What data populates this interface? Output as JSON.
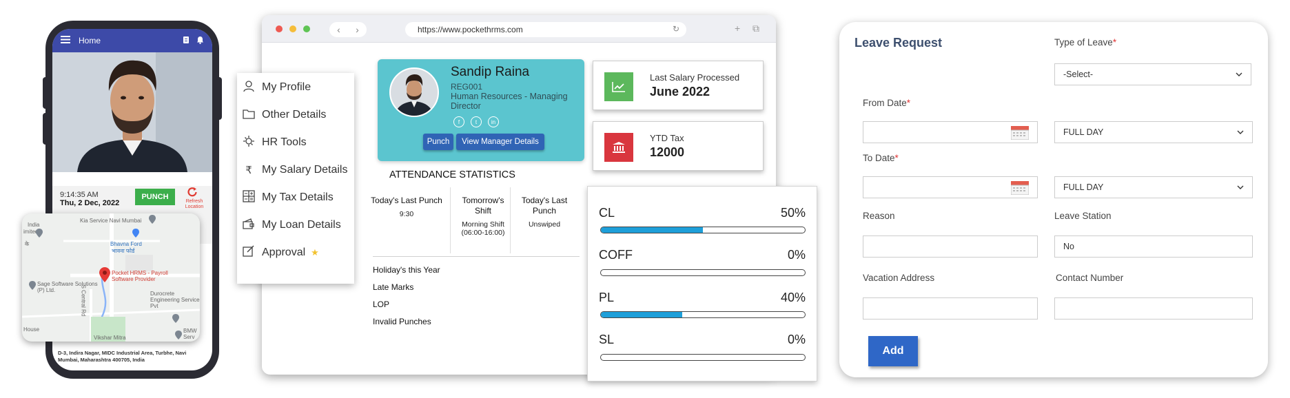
{
  "phone": {
    "header_title": "Home",
    "time": "9:14:35 AM",
    "date": "Thu, 2 Dec, 2022",
    "punch_label": "PUNCH",
    "refresh_label": "Refresh Location",
    "address": "D-3, Indira Nagar, MIDC Industrial Area, Turbhe, Navi Mumbai, Maharashtra 400705, India",
    "map_labels": {
      "kia": "Kia Service Navi Mumbai",
      "bhavna": "Bhavna Ford",
      "bhavna_hi": "भावना फोर्ड",
      "pocket": "Pocket HRMS - Payroll Software Provider",
      "sage": "Sage Software Solutions (P) Ltd.",
      "durocrete": "Durocrete Engineering Services Pvt",
      "india": "India",
      "limited": "imited",
      "hindi_left": "के",
      "central": "S Central Rd",
      "house": "House",
      "vikshar": "Vikshar Mitra",
      "bmw": "BMW Serv"
    }
  },
  "browser": {
    "url": "https://www.pockethrms.com"
  },
  "menu": {
    "items": [
      {
        "icon": "person-icon",
        "label": "My Profile"
      },
      {
        "icon": "folder-icon",
        "label": "Other Details"
      },
      {
        "icon": "tools-icon",
        "label": "HR Tools"
      },
      {
        "icon": "rupee-icon",
        "label": "My Salary Details"
      },
      {
        "icon": "calculator-icon",
        "label": "My Tax Details"
      },
      {
        "icon": "wallet-icon",
        "label": "My Loan Details"
      },
      {
        "icon": "approval-icon",
        "label": "Approval"
      }
    ]
  },
  "profile": {
    "name": "Sandip Raina",
    "code": "REG001",
    "department": "Human Resources - Managing Director",
    "punch_btn": "Punch",
    "manager_btn": "View Manager Details",
    "social": [
      "f",
      "t",
      "in"
    ]
  },
  "cards": {
    "salary_label": "Last Salary Processed",
    "salary_value": "June 2022",
    "tax_label": "YTD Tax",
    "tax_value": "12000"
  },
  "attendance": {
    "title": "ATTENDANCE STATISTICS",
    "columns": [
      {
        "header": "Today's Last Punch",
        "value": "9:30"
      },
      {
        "header": "Tomorrow's Shift",
        "value": "Morning Shift (06:00-16:00)"
      },
      {
        "header": "Today's Last Punch",
        "value": "Unswiped"
      }
    ],
    "rows": [
      "Holiday's this Year",
      "Late Marks",
      "LOP",
      "Invalid Punches"
    ]
  },
  "leave_balance": [
    {
      "name": "CL",
      "percent_label": "50%",
      "fraction": 0.5
    },
    {
      "name": "COFF",
      "percent_label": "0%",
      "fraction": 0
    },
    {
      "name": "PL",
      "percent_label": "40%",
      "fraction": 0.4
    },
    {
      "name": "SL",
      "percent_label": "0%",
      "fraction": 0
    }
  ],
  "leave_request": {
    "title": "Leave Request",
    "type_label": "Type of Leave",
    "type_value": "-Select-",
    "from_label": "From Date",
    "from_value": "",
    "from_day": "FULL DAY",
    "to_label": "To Date",
    "to_value": "",
    "to_day": "FULL DAY",
    "reason_label": "Reason",
    "reason_value": "",
    "station_label": "Leave Station",
    "station_value": "No",
    "vacation_label": "Vacation Address",
    "vacation_value": "",
    "contact_label": "Contact Number",
    "contact_value": "",
    "required_mark": "*",
    "add_label": "Add"
  },
  "colors": {
    "phone_header": "#3d4aa8",
    "punch_green": "#3cae4b",
    "profile_teal": "#5bc5cf",
    "button_blue": "#3064b5",
    "salary_icon": "#5cb85c",
    "tax_icon": "#d9363e",
    "progress": "#1e9fd9",
    "title_navy": "#3d4f6e"
  }
}
